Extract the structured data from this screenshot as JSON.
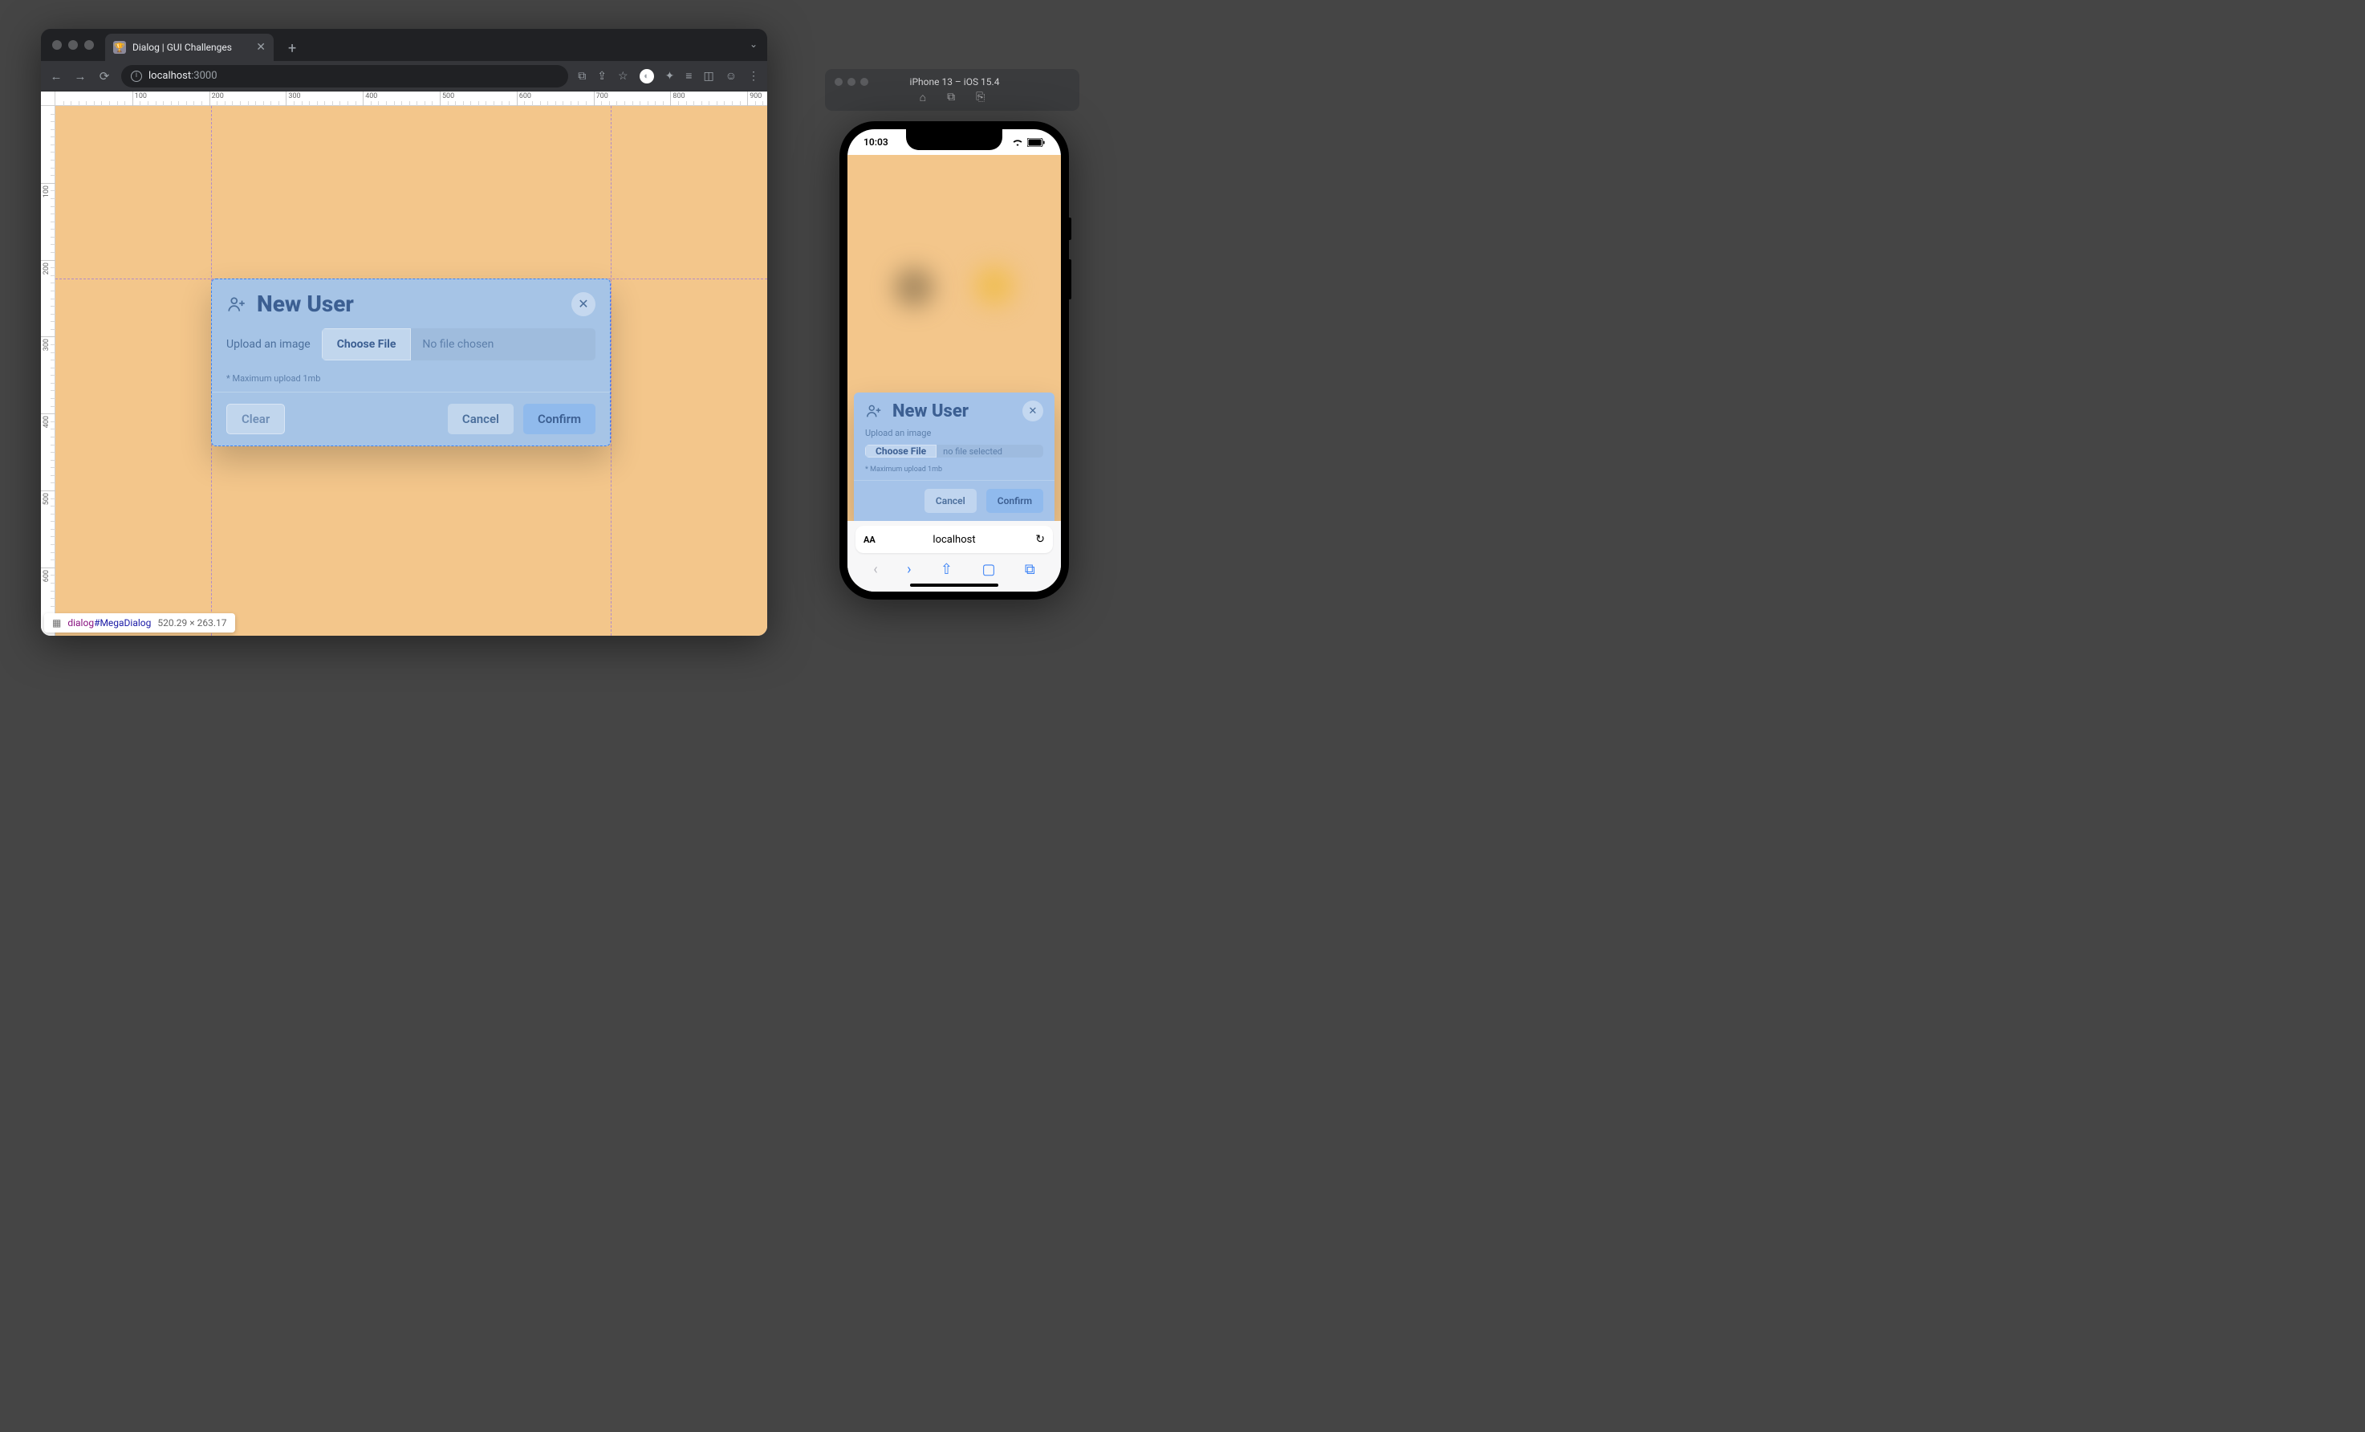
{
  "chrome": {
    "tab_title": "Dialog | GUI Challenges",
    "url_host": "localhost",
    "url_path": ":3000"
  },
  "rulers": {
    "h_ticks": [
      100,
      200,
      300,
      400,
      500,
      600,
      700,
      800,
      900
    ],
    "v_ticks": [
      100,
      200,
      300,
      400,
      500,
      600
    ]
  },
  "dialog": {
    "title": "New User",
    "upload_label": "Upload an image",
    "choose": "Choose File",
    "no_file": "No file chosen",
    "hint": "* Maximum upload 1mb",
    "clear": "Clear",
    "cancel": "Cancel",
    "confirm": "Confirm"
  },
  "chip": {
    "tag": "dialog",
    "id": "#MegaDialog",
    "dims": "520.29 × 263.17"
  },
  "sim": {
    "title": "iPhone 13 – iOS 15.4"
  },
  "phone": {
    "time": "10:03",
    "url": "localhost",
    "dialog": {
      "title": "New User",
      "upload_label": "Upload an image",
      "choose": "Choose File",
      "no_file": "no file selected",
      "hint": "* Maximum upload 1mb",
      "cancel": "Cancel",
      "confirm": "Confirm"
    }
  }
}
